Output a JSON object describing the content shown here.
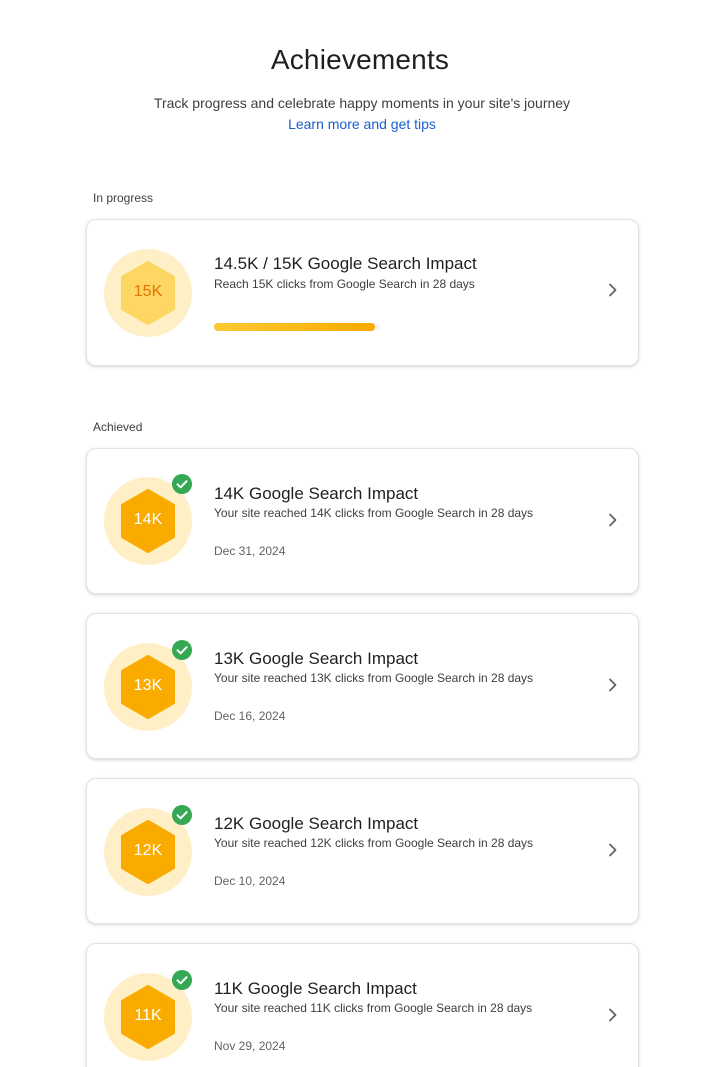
{
  "header": {
    "title": "Achievements",
    "subtitle": "Track progress and celebrate happy moments in your site's journey",
    "link_label": "Learn more and get tips"
  },
  "in_progress": {
    "section_label": "In progress",
    "item": {
      "badge_label": "15K",
      "title": "14.5K / 15K Google Search Impact",
      "description": "Reach 15K clicks from Google Search in 28 days",
      "progress_fraction": 0.967
    }
  },
  "achieved": {
    "section_label": "Achieved",
    "items": [
      {
        "badge_label": "14K",
        "title": "14K Google Search Impact",
        "description": "Your site reached 14K clicks from Google Search in 28 days",
        "date": "Dec 31, 2024"
      },
      {
        "badge_label": "13K",
        "title": "13K Google Search Impact",
        "description": "Your site reached 13K clicks from Google Search in 28 days",
        "date": "Dec 16, 2024"
      },
      {
        "badge_label": "12K",
        "title": "12K Google Search Impact",
        "description": "Your site reached 12K clicks from Google Search in 28 days",
        "date": "Dec 10, 2024"
      },
      {
        "badge_label": "11K",
        "title": "11K Google Search Impact",
        "description": "Your site reached 11K clicks from Google Search in 28 days",
        "date": "Nov 29, 2024"
      }
    ]
  },
  "icons": {
    "badge": "hexagon-badge-icon",
    "achieved_check": "check-circle-icon",
    "open": "chevron-right-icon"
  },
  "colors": {
    "link": "#1a5fd0",
    "badge_ring": "#feefc6",
    "badge_achieved": "#f9ab00",
    "badge_in_progress": "#fdd663",
    "badge_in_progress_text": "#e37400",
    "check": "#34a853",
    "progress_fill": "#f9ab00"
  }
}
